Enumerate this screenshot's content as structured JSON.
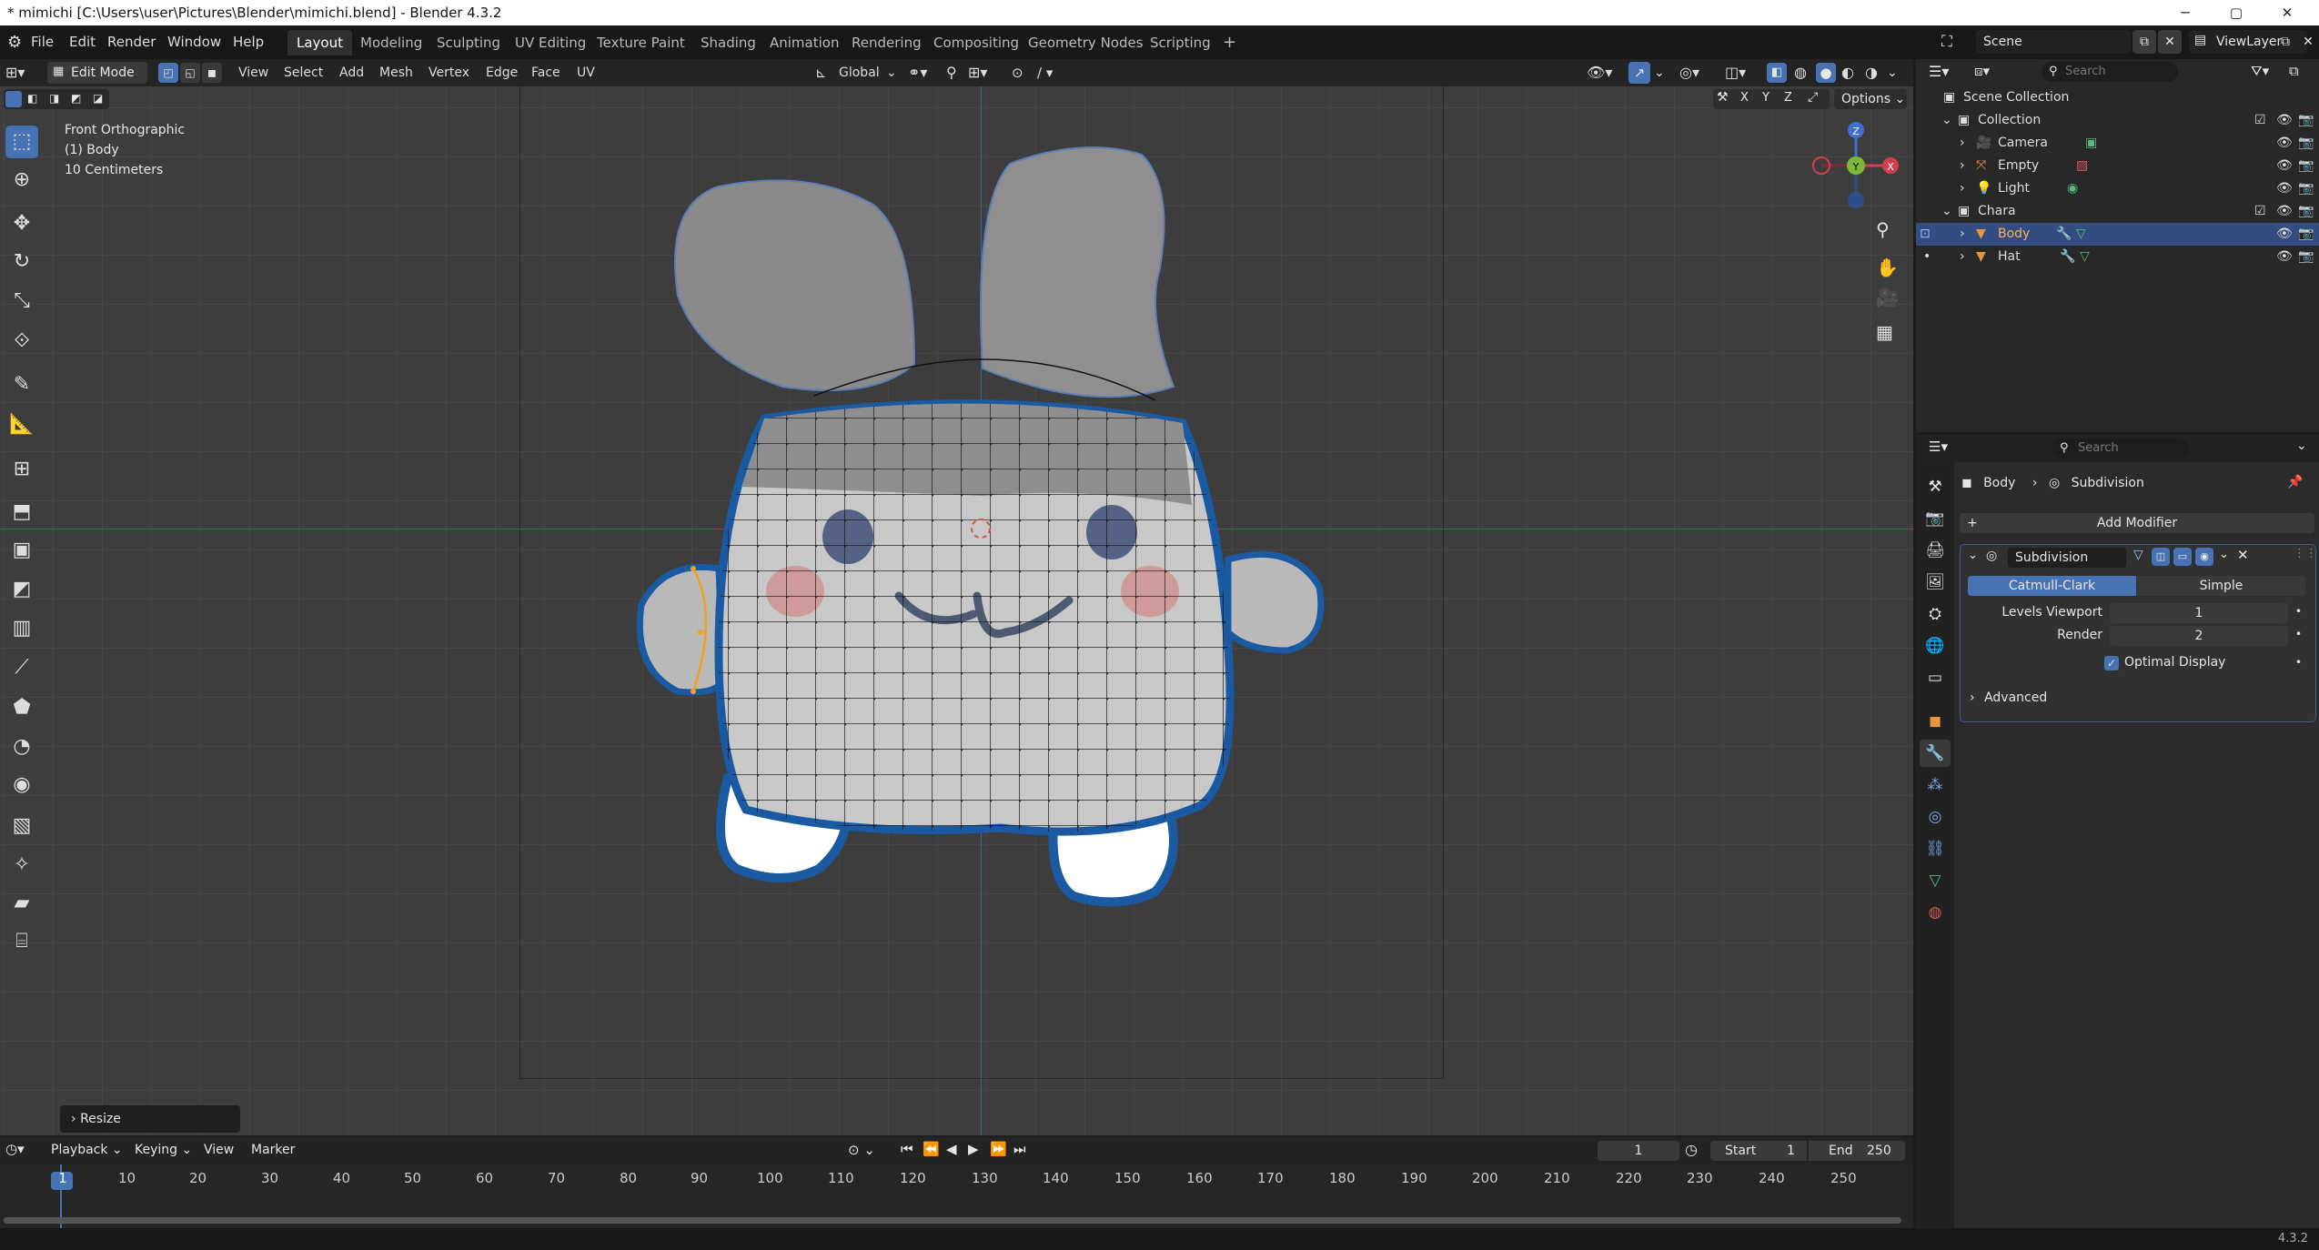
{
  "window": {
    "title": "* mimichi [C:\\Users\\user\\Pictures\\Blender\\mimichi.blend] - Blender 4.3.2",
    "controls": [
      "─",
      "▢",
      "✕"
    ]
  },
  "menu": {
    "items": [
      "File",
      "Edit",
      "Render",
      "Window",
      "Help"
    ],
    "workspaces": [
      "Layout",
      "Modeling",
      "Sculpting",
      "UV Editing",
      "Texture Paint",
      "Shading",
      "Animation",
      "Rendering",
      "Compositing",
      "Geometry Nodes",
      "Scripting"
    ],
    "add_tab": "+",
    "scene_label": "Scene",
    "view_layer_label": "ViewLayer"
  },
  "viewport_header": {
    "mode": "Edit Mode",
    "menus": [
      "View",
      "Select",
      "Add",
      "Mesh",
      "Vertex",
      "Edge",
      "Face",
      "UV"
    ],
    "transform_orientation": "Global",
    "options_label": "Options",
    "axes": [
      "X",
      "Y",
      "Z"
    ]
  },
  "viewport": {
    "view_name": "Front Orthographic",
    "object_label": "(1) Body",
    "scale_label": "10 Centimeters",
    "last_operator": "Resize",
    "gizmo_axes": [
      "Z",
      "Y",
      "X"
    ]
  },
  "outliner": {
    "search_placeholder": "Search",
    "root": "Scene Collection",
    "rows": [
      {
        "label": "Collection",
        "icon": "collection-icon"
      },
      {
        "label": "Camera",
        "icon": "camera-icon"
      },
      {
        "label": "Empty",
        "icon": "empty-icon"
      },
      {
        "label": "Light",
        "icon": "light-icon"
      },
      {
        "label": "Chara",
        "icon": "collection-icon"
      },
      {
        "label": "Body",
        "icon": "mesh-icon",
        "selected": true
      },
      {
        "label": "Hat",
        "icon": "mesh-icon"
      }
    ]
  },
  "properties": {
    "search_placeholder": "Search",
    "breadcrumb_object": "Body",
    "breadcrumb_modifier": "Subdivision",
    "add_modifier": "Add Modifier",
    "modifier_name": "Subdivision",
    "mode_catmull": "Catmull-Clark",
    "mode_simple": "Simple",
    "levels_viewport_label": "Levels Viewport",
    "levels_viewport_value": "1",
    "render_label": "Render",
    "render_value": "2",
    "optimal_display_label": "Optimal Display",
    "optimal_display_checked": true,
    "advanced_label": "Advanced"
  },
  "timeline": {
    "menus": [
      "Playback",
      "Keying",
      "View",
      "Marker"
    ],
    "current_frame": "1",
    "start_label": "Start",
    "start_value": "1",
    "end_label": "End",
    "end_value": "250",
    "ruler": [
      "1",
      "10",
      "20",
      "30",
      "40",
      "50",
      "60",
      "70",
      "80",
      "90",
      "100",
      "110",
      "120",
      "130",
      "140",
      "150",
      "160",
      "170",
      "180",
      "190",
      "200",
      "210",
      "220",
      "230",
      "240",
      "250"
    ]
  },
  "status": {
    "version": "4.3.2"
  },
  "colors": {
    "accent": "#4772b3",
    "selection": "#334d80",
    "viewport_bg": "#3d3d3d",
    "edge_select": "#f0a020"
  }
}
